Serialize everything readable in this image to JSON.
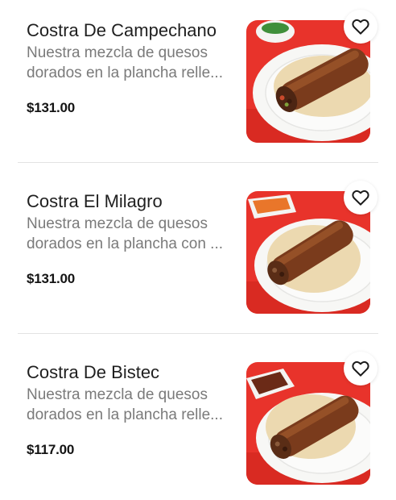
{
  "menu_items": [
    {
      "title": "Costra De Campechano",
      "description": "Nuestra mezcla de quesos dorados en la plancha relle...",
      "price": "$131.00",
      "image_icon": "food-photo-campechano",
      "favorite_icon": "heart-outline-icon"
    },
    {
      "title": "Costra El Milagro",
      "description": "Nuestra mezcla de quesos dorados en la plancha con ...",
      "price": "$131.00",
      "image_icon": "food-photo-milagro",
      "favorite_icon": "heart-outline-icon"
    },
    {
      "title": "Costra De Bistec",
      "description": "Nuestra mezcla de quesos dorados en la plancha relle...",
      "price": "$117.00",
      "image_icon": "food-photo-bistec",
      "favorite_icon": "heart-outline-icon"
    }
  ],
  "colors": {
    "image_background": "#e8332b",
    "plate": "#f7f7f5",
    "tortilla": "#ecd9b0",
    "costra": "#7a3b1c"
  }
}
